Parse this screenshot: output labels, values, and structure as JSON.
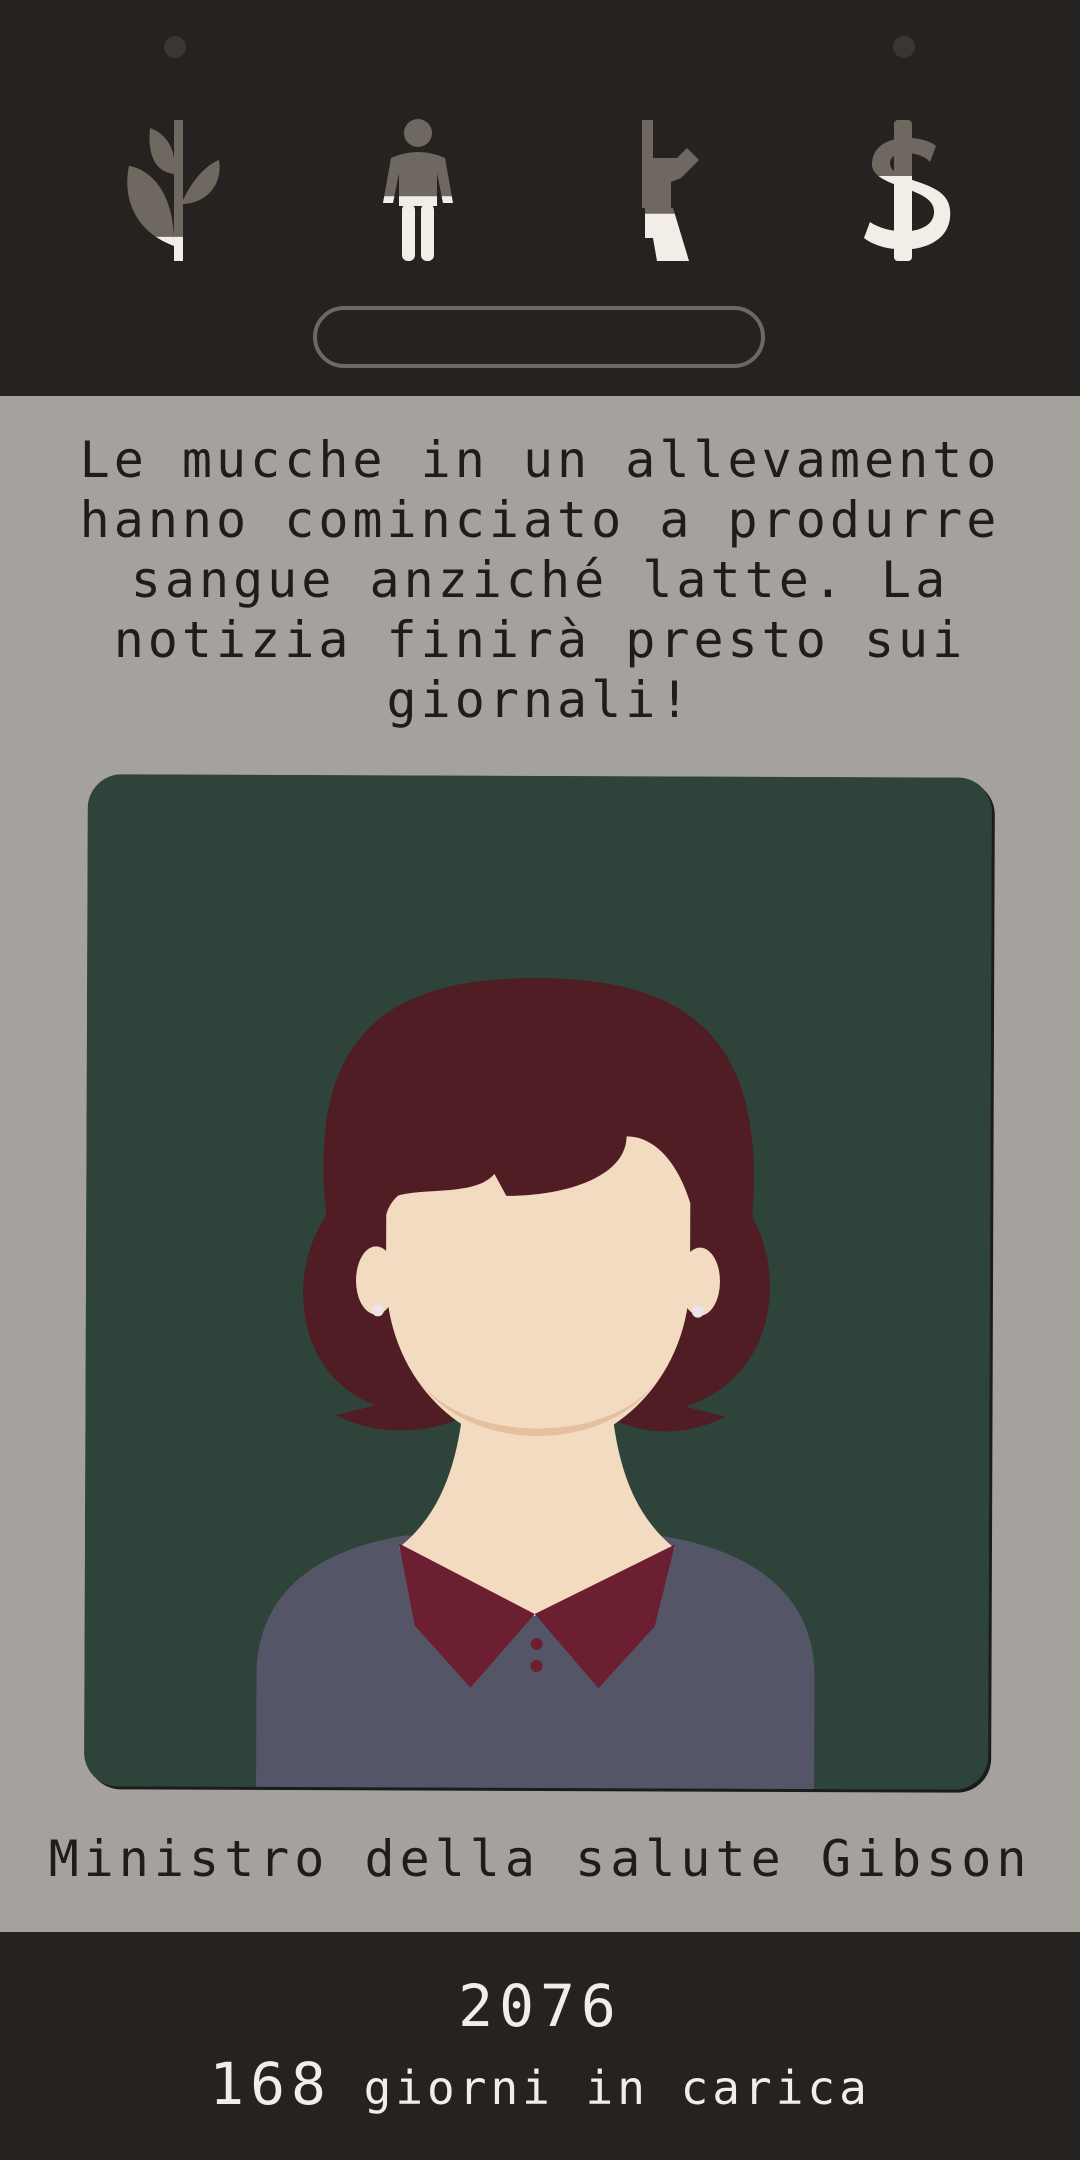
{
  "stats": [
    {
      "name": "religion",
      "icon": "sprout-icon",
      "level": 0.18
    },
    {
      "name": "people",
      "icon": "person-icon",
      "level": 0.46
    },
    {
      "name": "military",
      "icon": "rifle-icon",
      "level": 0.34
    },
    {
      "name": "money",
      "icon": "dollar-icon",
      "level": 0.6
    }
  ],
  "event": {
    "text": "Le mucche in un allevamento hanno cominciato a produrre sangue anziché latte. La notizia finirà presto sui giornali!"
  },
  "character": {
    "name": "Ministro della salute Gibson"
  },
  "status": {
    "year": "2076",
    "days_count": "168",
    "days_label": "giorni in carica"
  },
  "colors": {
    "bar_bg": "#252220",
    "main_bg": "#a5a19d",
    "card_bg": "#2e433a",
    "icon_empty": "#6f6861",
    "icon_full": "#f2ede7",
    "hair": "#511d25",
    "skin": "#f3dbc1",
    "collar": "#6c1f31",
    "shirt": "#545566"
  }
}
